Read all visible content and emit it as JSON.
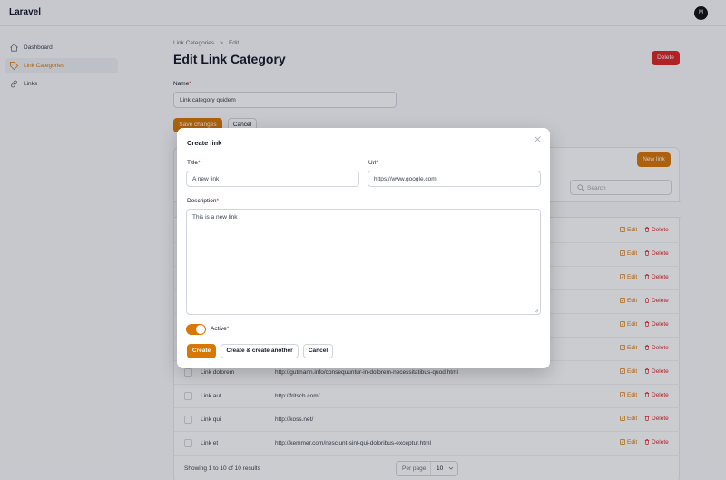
{
  "app": {
    "brand": "Laravel",
    "avatar_initial": "M"
  },
  "sidebar": {
    "items": [
      {
        "label": "Dashboard",
        "icon": "home-icon",
        "active": false
      },
      {
        "label": "Link Categories",
        "icon": "tag-icon",
        "active": true
      },
      {
        "label": "Links",
        "icon": "link-icon",
        "active": false
      }
    ]
  },
  "page": {
    "breadcrumb": [
      "Link Categories",
      "Edit"
    ],
    "title": "Edit Link Category",
    "delete_label": "Delete",
    "name_label": "Name",
    "name_value": "Link category quidem",
    "save_label": "Save changes",
    "cancel_label": "Cancel"
  },
  "links_table": {
    "new_label": "New link",
    "search_placeholder": "Search",
    "edit_label": "Edit",
    "delete_label": "Delete",
    "rows": [
      {
        "title": "",
        "url": ""
      },
      {
        "title": "",
        "url": ""
      },
      {
        "title": "",
        "url": ""
      },
      {
        "title": "",
        "url": ""
      },
      {
        "title": "",
        "url": ""
      },
      {
        "title": "",
        "url": ""
      },
      {
        "title": "Link dolorem",
        "url": "http://gutmann.info/consequuntur-in-dolorem-necessitatibus-quod.html"
      },
      {
        "title": "Link aut",
        "url": "http://fritsch.com/"
      },
      {
        "title": "Link qui",
        "url": "http://koss.net/"
      },
      {
        "title": "Link et",
        "url": "http://kemmer.com/nesciunt-sint-qui-doloribus-exceptur.html"
      }
    ],
    "footer": "Showing 1 to 10 of 10 results",
    "per_page_label": "Per page",
    "per_page_value": "10"
  },
  "modal": {
    "title": "Create link",
    "title_label": "Title",
    "title_value": "A new link",
    "url_label": "Url",
    "url_value": "https://www.google.com",
    "description_label": "Description",
    "description_value": "This is a new link",
    "active_label": "Active",
    "active_on": true,
    "create_label": "Create",
    "create_another_label": "Create & create another",
    "cancel_label": "Cancel"
  },
  "colors": {
    "accent": "#d97706",
    "danger": "#dc2626"
  }
}
